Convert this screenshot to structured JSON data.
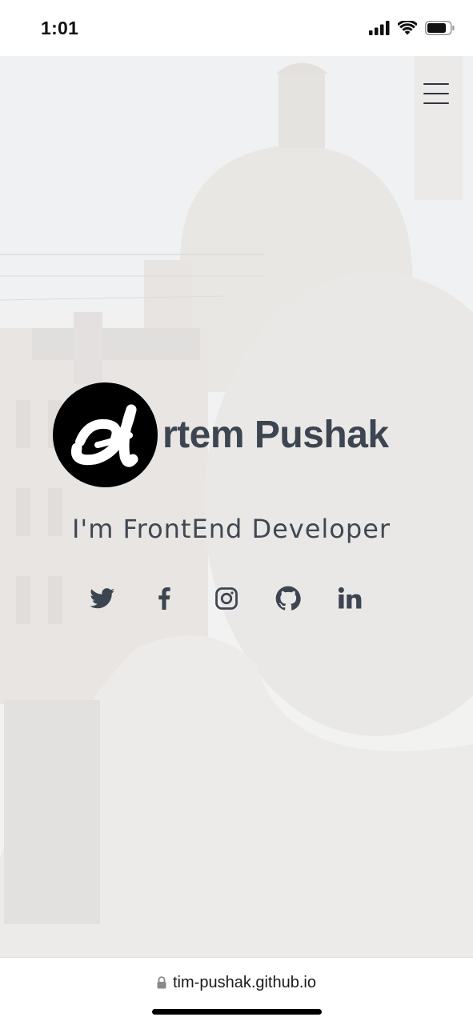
{
  "status_bar": {
    "time": "1:01",
    "icons": [
      "signal-icon",
      "wifi-icon",
      "battery-icon"
    ]
  },
  "hero": {
    "menu_icon": "hamburger-menu-icon",
    "logo_letter": "A",
    "name": "rtem Pushak",
    "tagline": "I'm FrontEnd Developer",
    "socials": [
      {
        "name": "twitter-icon"
      },
      {
        "name": "facebook-icon"
      },
      {
        "name": "instagram-icon"
      },
      {
        "name": "github-icon"
      },
      {
        "name": "linkedin-icon"
      }
    ],
    "colors": {
      "text": "#3c4550",
      "logo_bg": "#000000",
      "logo_letter": "#ffffff"
    }
  },
  "browser": {
    "url": "tim-pushak.github.io",
    "lock_icon": "lock-icon"
  }
}
